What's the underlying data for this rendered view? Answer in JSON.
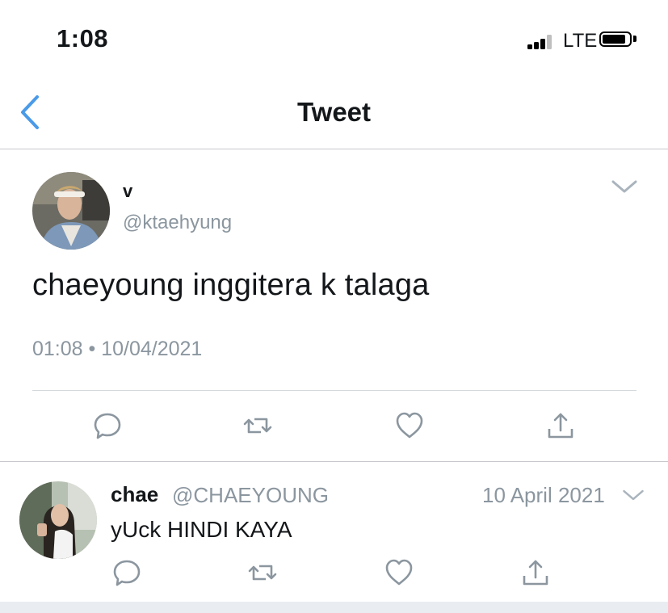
{
  "status_bar": {
    "time": "1:08",
    "network": "LTE",
    "icons": [
      "signal-icon",
      "battery-icon"
    ]
  },
  "nav": {
    "title": "Tweet",
    "back_icon": "chevron-left-icon",
    "accent_color": "#4a9ae8"
  },
  "tweet": {
    "display_name": "v",
    "handle": "@ktaehyung",
    "text": "chaeyoung inggitera k talaga",
    "timestamp": "01:08 • 10/04/2021",
    "actions": [
      "reply-icon",
      "retweet-icon",
      "like-icon",
      "share-icon"
    ]
  },
  "reply": {
    "display_name": "chae",
    "handle": "@CHAEYOUNG",
    "date": "10 April 2021",
    "text": "yUck HINDI KAYA",
    "actions": [
      "reply-icon",
      "retweet-icon",
      "like-icon",
      "share-icon"
    ]
  },
  "colors": {
    "icon_gray": "#8b969f",
    "divider": "#c8c8cc",
    "text": "#14171a"
  }
}
